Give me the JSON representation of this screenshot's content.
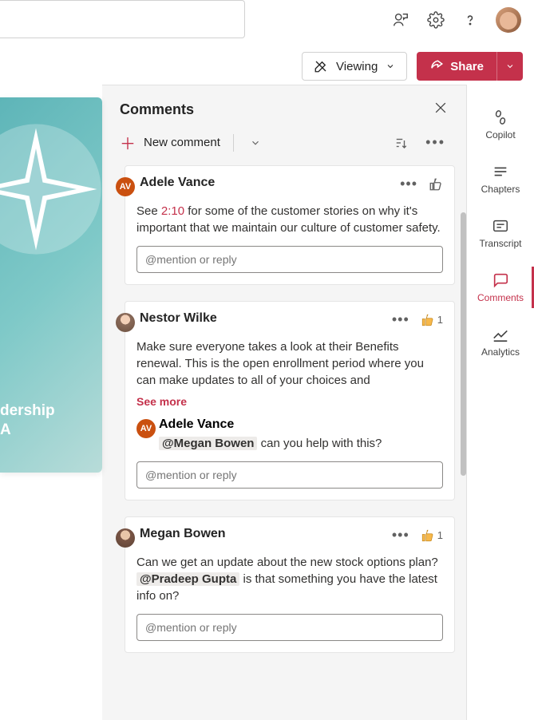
{
  "topbar": {
    "viewing_label": "Viewing",
    "share_label": "Share"
  },
  "comments_panel": {
    "title": "Comments",
    "new_comment_label": "New comment",
    "reply_placeholder": "@mention or reply"
  },
  "rightbar": {
    "copilot": "Copilot",
    "chapters": "Chapters",
    "transcript": "Transcript",
    "comments": "Comments",
    "analytics": "Analytics"
  },
  "doc_preview": {
    "line1": "dership",
    "line2": "A"
  },
  "comments": [
    {
      "author": "Adele Vance",
      "avatar_initials": "AV",
      "avatar_class": "av-orange",
      "body_pre": "See ",
      "timestamp": "2:10",
      "body_post": " for some of the customer stories on why it's important that we maintain our culture of customer safety.",
      "like_count": "",
      "show_like_count": false,
      "see_more": false,
      "nested": null
    },
    {
      "author": "Nestor Wilke",
      "avatar_initials": "",
      "avatar_class": "av-photo1",
      "body": "Make sure everyone takes a look at their Benefits renewal. This is the open enrollment period where you can make updates to all of your choices and",
      "like_count": "1",
      "show_like_count": true,
      "see_more": true,
      "see_more_label": "See more",
      "nested": {
        "author": "Adele Vance",
        "avatar_initials": "AV",
        "avatar_class": "av-orange",
        "mention": "@Megan Bowen",
        "body_post": " can you help with this?"
      }
    },
    {
      "author": "Megan Bowen",
      "avatar_initials": "",
      "avatar_class": "av-photo2",
      "body_pre": "Can we get an update about the new stock options plan? ",
      "mention": "@Pradeep Gupta",
      "body_post": " is that something you have the latest info on?",
      "like_count": "1",
      "show_like_count": true,
      "see_more": false,
      "nested": null
    }
  ]
}
